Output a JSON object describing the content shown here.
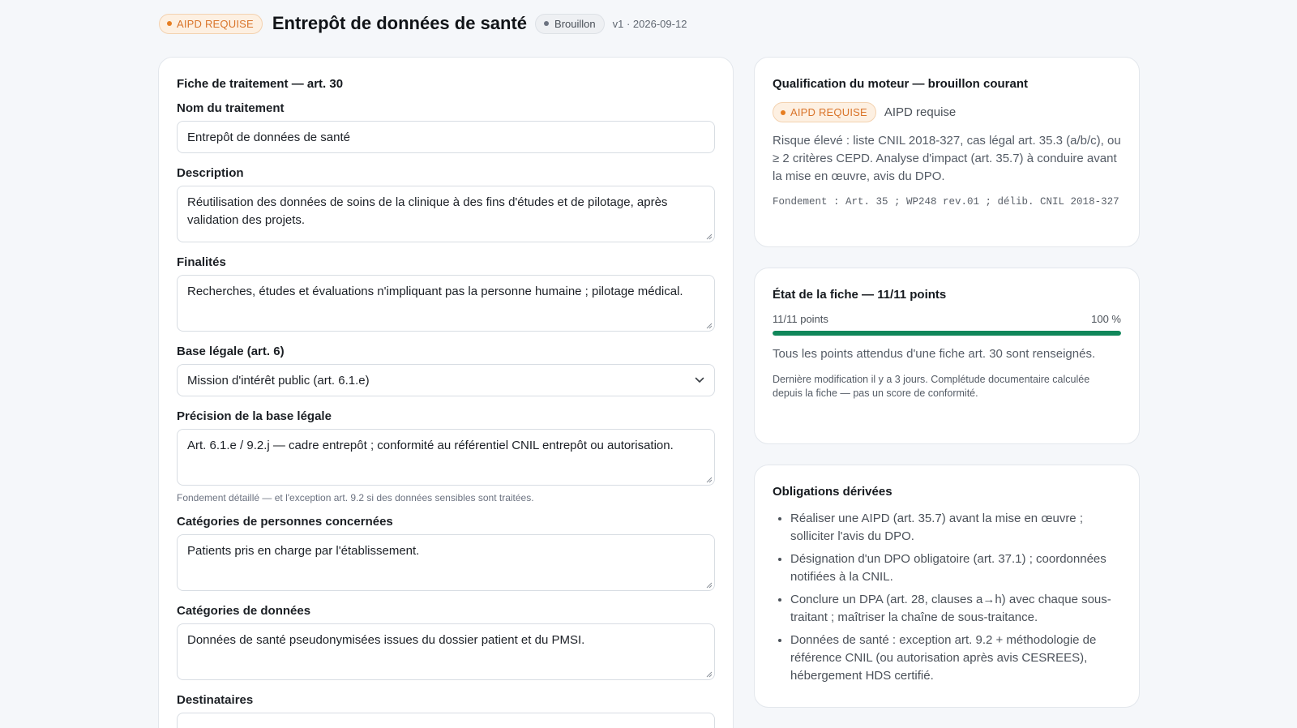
{
  "header": {
    "badge": "AIPD REQUISE",
    "title": "Entrepôt de données de santé",
    "status": "Brouillon",
    "version": "v1 · 2026-09-12"
  },
  "form": {
    "section_title": "Fiche de traitement — art. 30",
    "fields": {
      "nom": {
        "label": "Nom du traitement",
        "value": "Entrepôt de données de santé"
      },
      "description": {
        "label": "Description",
        "value": "Réutilisation des données de soins de la clinique à des fins d'études et de pilotage, après validation des projets."
      },
      "finalites": {
        "label": "Finalités",
        "value": "Recherches, études et évaluations n'impliquant pas la personne humaine ; pilotage médical."
      },
      "base_legale": {
        "label": "Base légale (art. 6)",
        "value": "Mission d'intérêt public (art. 6.1.e)"
      },
      "precision": {
        "label": "Précision de la base légale",
        "value": "Art. 6.1.e / 9.2.j — cadre entrepôt ; conformité au référentiel CNIL entrepôt ou autorisation.",
        "help": "Fondement détaillé — et l'exception art. 9.2 si des données sensibles sont traitées."
      },
      "personnes": {
        "label": "Catégories de personnes concernées",
        "value": "Patients pris en charge par l'établissement."
      },
      "donnees": {
        "label": "Catégories de données",
        "value": "Données de santé pseudonymisées issues du dossier patient et du PMSI."
      },
      "destinataires": {
        "label": "Destinataires"
      }
    }
  },
  "qualification": {
    "title": "Qualification du moteur — brouillon courant",
    "badge": "AIPD REQUISE",
    "label": "AIPD requise",
    "text": "Risque élevé : liste CNIL 2018-327, cas légal art. 35.3 (a/b/c), ou ≥ 2 critères CEPD. Analyse d'impact (art. 35.7) à conduire avant la mise en œuvre, avis du DPO.",
    "basis": "Fondement : Art. 35 ; WP248 rev.01 ; délib. CNIL 2018-327"
  },
  "state": {
    "title": "État de la fiche — 11/11 points",
    "points_label": "11/11 points",
    "percent_label": "100 %",
    "progress": 1.0,
    "text": "Tous les points attendus d'une fiche art. 30 sont renseignés.",
    "note": "Dernière modification il y a 3 jours. Complétude documentaire calculée depuis la fiche — pas un score de conformité."
  },
  "obligations": {
    "title": "Obligations dérivées",
    "items": [
      "Réaliser une AIPD (art. 35.7) avant la mise en œuvre ; solliciter l'avis du DPO.",
      "Désignation d'un DPO obligatoire (art. 37.1) ; coordonnées notifiées à la CNIL.",
      "Conclure un DPA (art. 28, clauses a→h) avec chaque sous-traitant ; maîtriser la chaîne de sous-traitance.",
      "Données de santé : exception art. 9.2 + méthodologie de référence CNIL (ou autorisation après avis CESREES), hébergement HDS certifié."
    ]
  },
  "colors": {
    "warn": "#e67e22",
    "progress": "#10875a"
  }
}
